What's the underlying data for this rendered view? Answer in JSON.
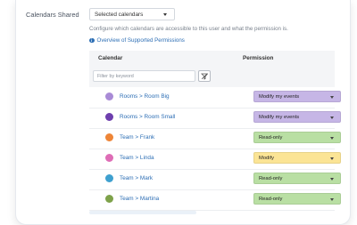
{
  "calendars_shared": {
    "label": "Calendars Shared",
    "select_value": "Selected calendars"
  },
  "description": "Configure which calendars are accessible to this user and what the permission is.",
  "overview_link": "Overview of Supported Permissions",
  "table": {
    "headers": {
      "calendar": "Calendar",
      "permission": "Permission"
    },
    "filter_placeholder": "Filter by keyword",
    "rows": [
      {
        "name": "Rooms > Room Big",
        "dot_color": "#a98bd6",
        "permission": "Modify my events",
        "perm_color": "#c6b6e6"
      },
      {
        "name": "Rooms > Room Small",
        "dot_color": "#6e3fae",
        "permission": "Modify my events",
        "perm_color": "#c6b6e6"
      },
      {
        "name": "Team > Frank",
        "dot_color": "#ee8537",
        "permission": "Read-only",
        "perm_color": "#b9dfa3"
      },
      {
        "name": "Team > Linda",
        "dot_color": "#de6db6",
        "permission": "Modify",
        "perm_color": "#fbe495"
      },
      {
        "name": "Team > Mark",
        "dot_color": "#3fa0cf",
        "permission": "Read-only",
        "perm_color": "#b9dfa3"
      },
      {
        "name": "Team > Martina",
        "dot_color": "#7ea24a",
        "permission": "Read-only",
        "perm_color": "#b9dfa3"
      }
    ]
  },
  "icons": {
    "select_caret": "chevron-down-icon",
    "info": "info-icon",
    "filter_clear": "clear-filter-icon"
  }
}
